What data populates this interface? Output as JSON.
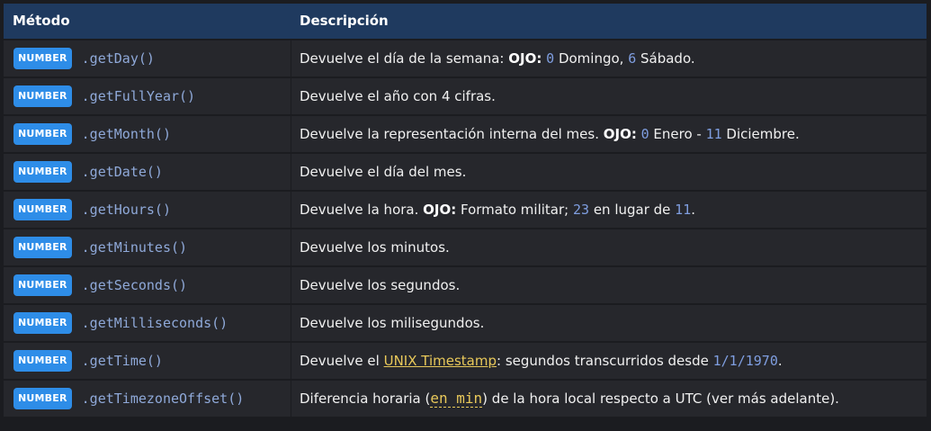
{
  "header": {
    "col_method": "Método",
    "col_description": "Descripción"
  },
  "rows": [
    {
      "type": "NUMBER",
      "method": ".getDay()",
      "desc": {
        "a": "Devuelve el día de la semana: ",
        "ojo": "OJO:",
        "b": " ",
        "n1": "0",
        "c": " Domingo, ",
        "n2": "6",
        "d": " Sábado."
      }
    },
    {
      "type": "NUMBER",
      "method": ".getFullYear()",
      "desc": {
        "text": "Devuelve el año con 4 cifras."
      }
    },
    {
      "type": "NUMBER",
      "method": ".getMonth()",
      "desc": {
        "a": "Devuelve la representación interna del mes. ",
        "ojo": "OJO:",
        "b": " ",
        "n1": "0",
        "c": " Enero - ",
        "n2": "11",
        "d": " Diciembre."
      }
    },
    {
      "type": "NUMBER",
      "method": ".getDate()",
      "desc": {
        "text": "Devuelve el día del mes."
      }
    },
    {
      "type": "NUMBER",
      "method": ".getHours()",
      "desc": {
        "a": "Devuelve la hora. ",
        "ojo": "OJO:",
        "b": " Formato militar; ",
        "n1": "23",
        "c": " en lugar de ",
        "n2": "11",
        "d": "."
      }
    },
    {
      "type": "NUMBER",
      "method": ".getMinutes()",
      "desc": {
        "text": "Devuelve los minutos."
      }
    },
    {
      "type": "NUMBER",
      "method": ".getSeconds()",
      "desc": {
        "text": "Devuelve los segundos."
      }
    },
    {
      "type": "NUMBER",
      "method": ".getMilliseconds()",
      "desc": {
        "text": "Devuelve los milisegundos."
      }
    },
    {
      "type": "NUMBER",
      "method": ".getTime()",
      "desc": {
        "a": "Devuelve el ",
        "link": "UNIX Timestamp",
        "b": ": segundos transcurridos desde ",
        "n1": "1/1/1970",
        "c": "."
      }
    },
    {
      "type": "NUMBER",
      "method": ".getTimezoneOffset()",
      "desc": {
        "a": "Diferencia horaria (",
        "unit": "en min",
        "b": ") de la hora local respecto a UTC (ver más adelante)."
      }
    }
  ],
  "colors": {
    "header_bg": "#1f3a5f",
    "badge": "#2e8de8",
    "number": "#7f9ee0",
    "link": "#e8c85a",
    "row_bg": "#26272c"
  }
}
